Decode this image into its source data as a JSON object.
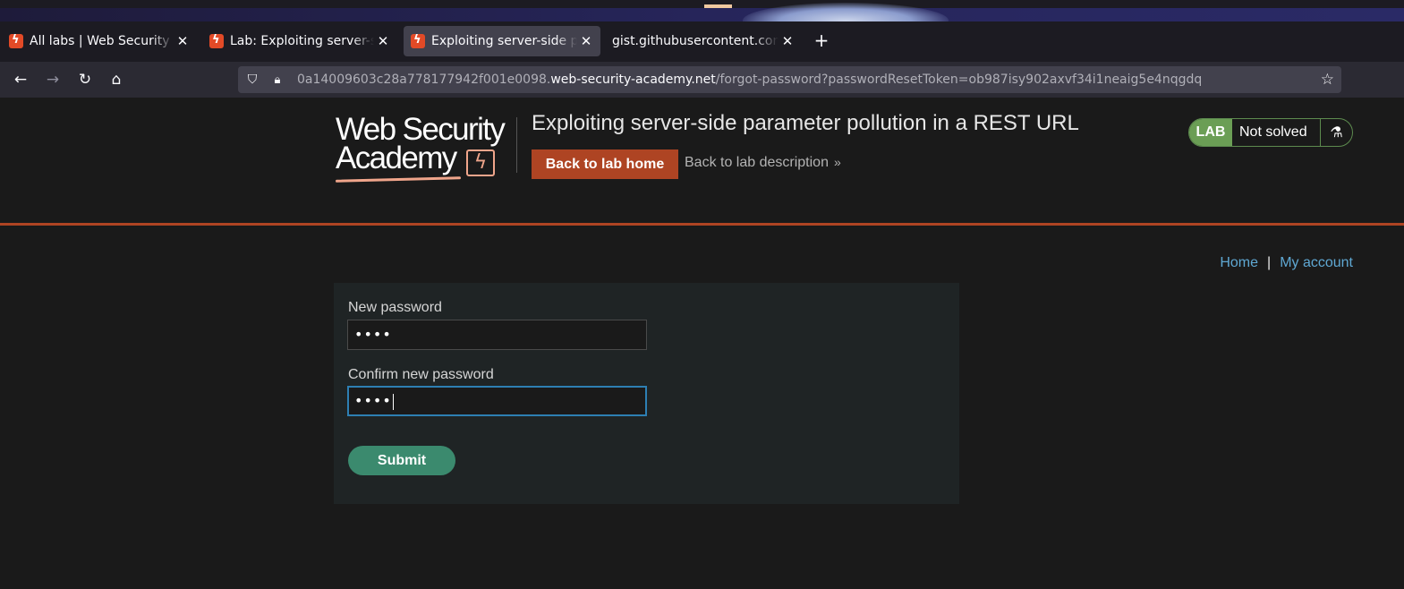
{
  "browser": {
    "tabs": [
      {
        "title": "All labs | Web Security Academy",
        "active": false
      },
      {
        "title": "Lab: Exploiting server-side parameter pollution",
        "active": false
      },
      {
        "title": "Exploiting server-side parameter pollution",
        "active": true
      },
      {
        "title": "gist.githubusercontent.com/",
        "active": false
      }
    ],
    "url_prefix": "0a14009603c28a778177942f001e0098.",
    "url_domain": "web-security-academy.net",
    "url_path": "/forgot-password?passwordResetToken=ob987isy902axvf34i1neaig5e4nqgdq"
  },
  "header": {
    "logo_line1": "Web Security",
    "logo_line2": "Academy",
    "lab_title": "Exploiting server-side parameter pollution in a REST URL",
    "back_home_label": "Back to lab home",
    "back_desc_label": "Back to lab description",
    "status_tag": "LAB",
    "status_text": "Not solved"
  },
  "nav_links": {
    "home": "Home",
    "separator": "|",
    "account": "My account"
  },
  "form": {
    "new_password_label": "New password",
    "new_password_value": "••••",
    "confirm_password_label": "Confirm new password",
    "confirm_password_value": "••••",
    "submit_label": "Submit"
  },
  "colors": {
    "accent": "#ae4423",
    "solved_green": "#6b9e55",
    "submit_green": "#3b8a6e",
    "link_blue": "#5fa8d3"
  }
}
